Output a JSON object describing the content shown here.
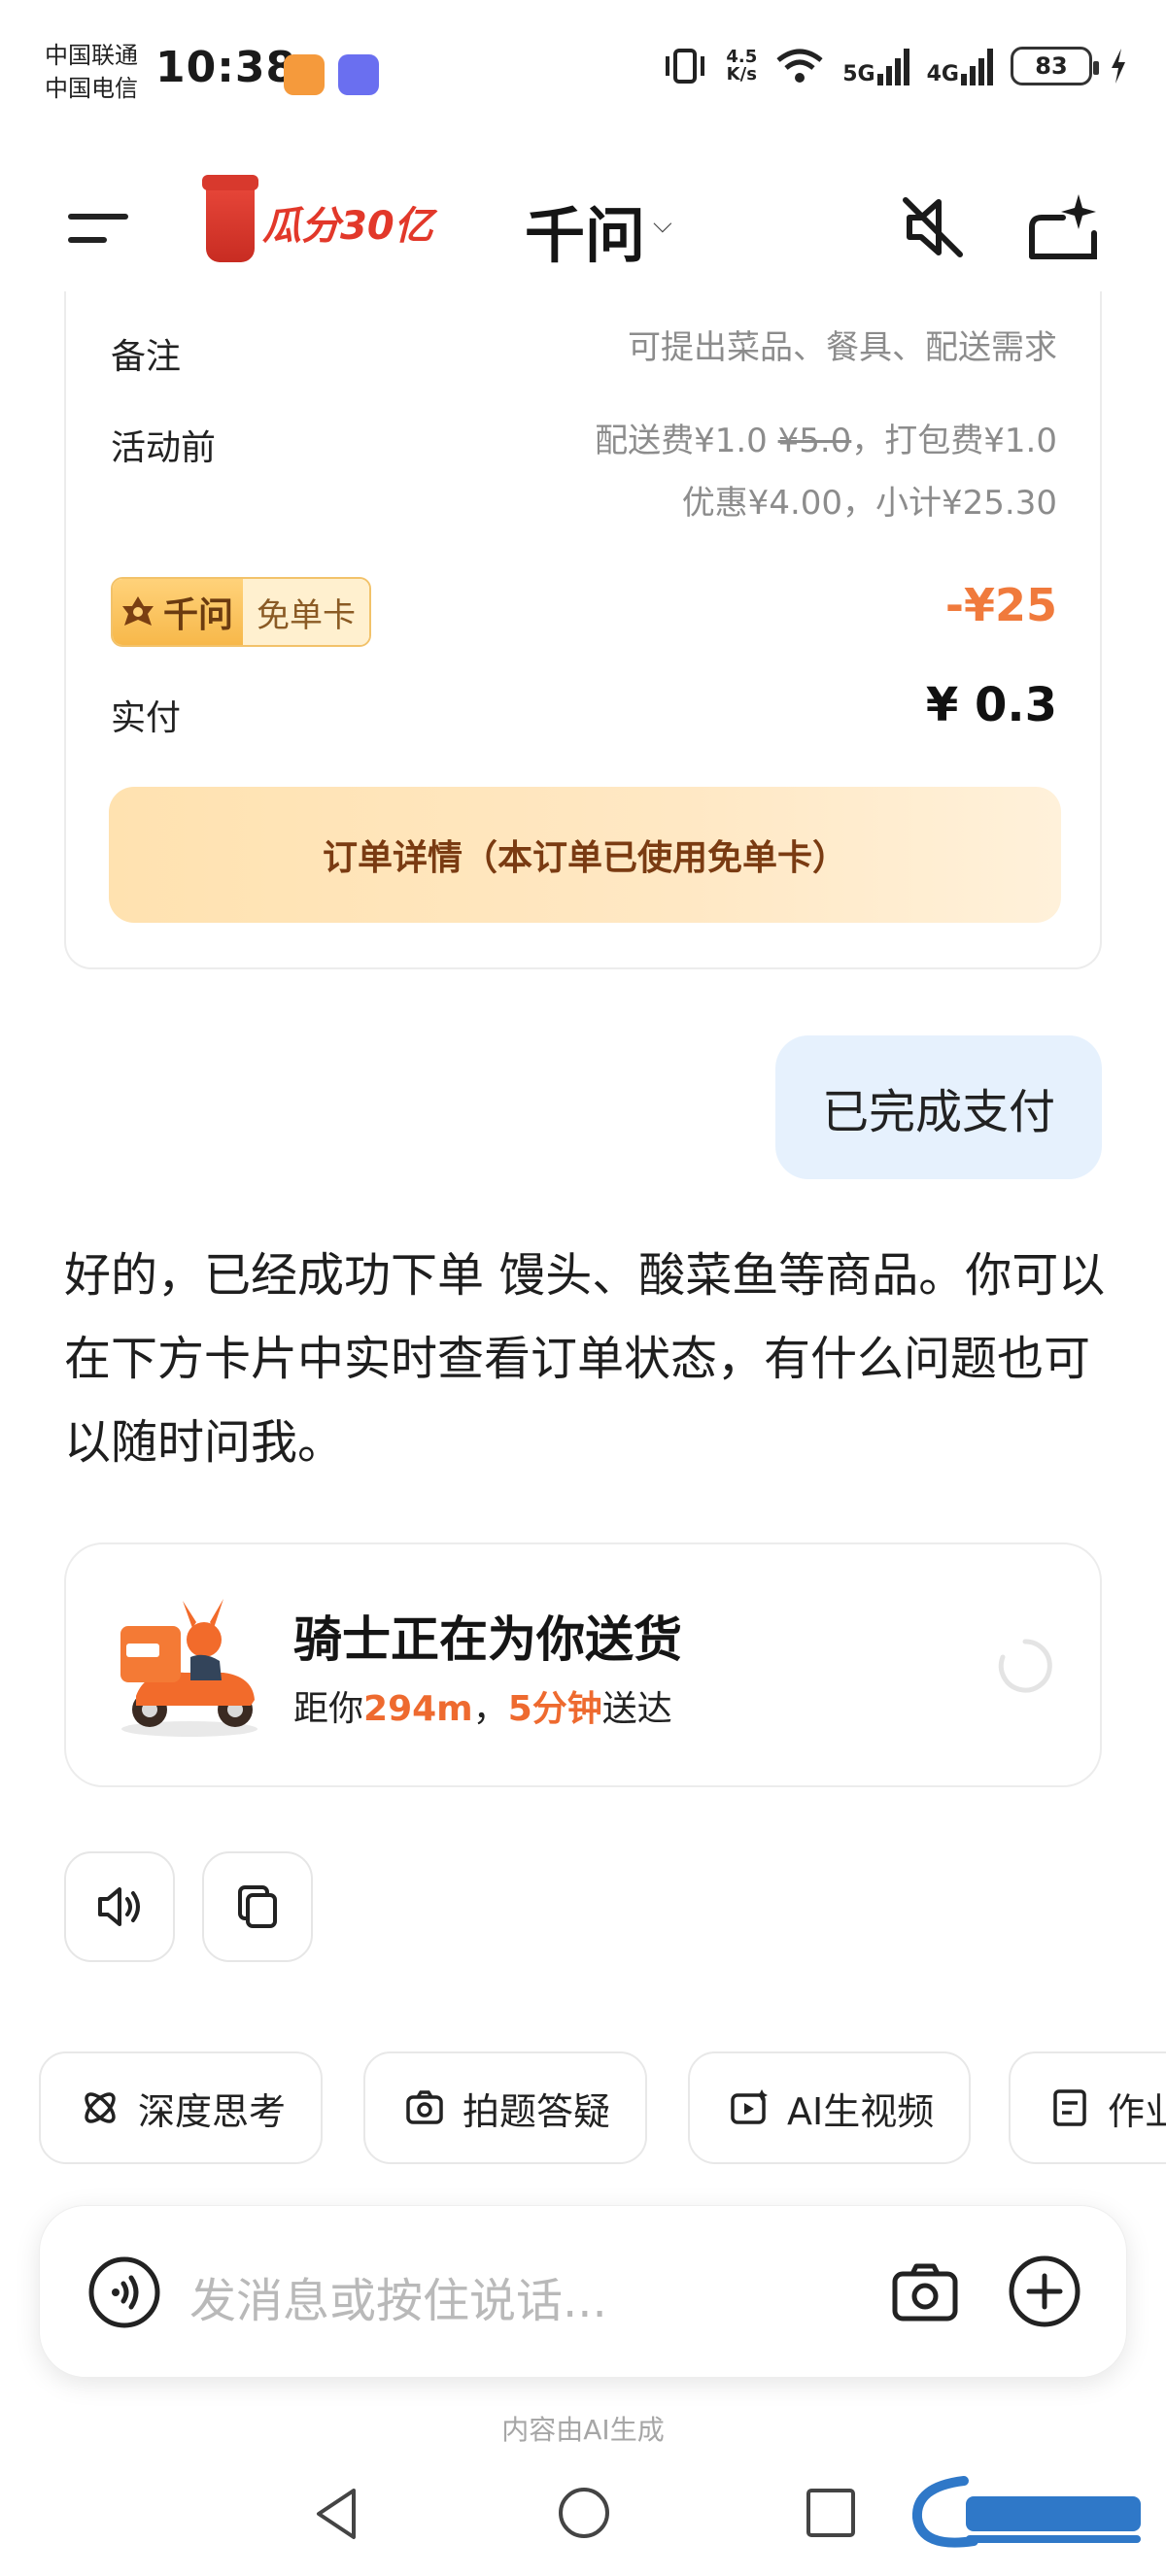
{
  "status_bar": {
    "carrier_1": "中国联通",
    "carrier_2": "中国电信",
    "time": "10:38",
    "net_speed_value": "4.5",
    "net_speed_unit": "K/s",
    "network_1": "5G",
    "network_2": "4G",
    "battery": "83"
  },
  "header": {
    "promo_text": "瓜分30亿",
    "app_title": "千问",
    "title_caret": "⌵"
  },
  "order_card": {
    "remark_label": "备注",
    "remark_value": "可提出菜品、餐具、配送需求",
    "before_label": "活动前",
    "before_line1_a": "配送费¥1.0 ",
    "before_line1_strike": "¥5.0",
    "before_line1_b": "，打包费¥1.0",
    "before_line2": "优惠¥4.00，小计¥25.30",
    "free_card_logo": "千问",
    "free_card_text": "免单卡",
    "free_card_discount": "-¥25",
    "paid_label": "实付",
    "paid_value": "¥ 0.3",
    "detail_button": "订单详情（本订单已使用免单卡）"
  },
  "user_message": "已完成支付",
  "ai_message": "好的，已经成功下单 馒头、酸菜鱼等商品。你可以在下方卡片中实时查看订单状态，有什么问题也可以随时问我。",
  "delivery": {
    "title": "骑士正在为你送货",
    "sub_prefix": "距你",
    "distance": "294m",
    "sep": "，",
    "eta": "5分钟",
    "sub_suffix": "送达"
  },
  "chips": [
    {
      "label": "深度思考",
      "icon": "deep-think-icon"
    },
    {
      "label": "拍题答疑",
      "icon": "photo-question-icon"
    },
    {
      "label": "AI生视频",
      "icon": "ai-video-icon"
    },
    {
      "label": "作业",
      "icon": "homework-icon"
    }
  ],
  "input": {
    "placeholder": "发消息或按住说话..."
  },
  "footer_note": "内容由AI生成",
  "colors": {
    "accent_orange": "#ee6a2f",
    "user_bubble": "#e6f1fd",
    "detail_button_text": "#7a3b12",
    "promo_red": "#e2382a"
  }
}
